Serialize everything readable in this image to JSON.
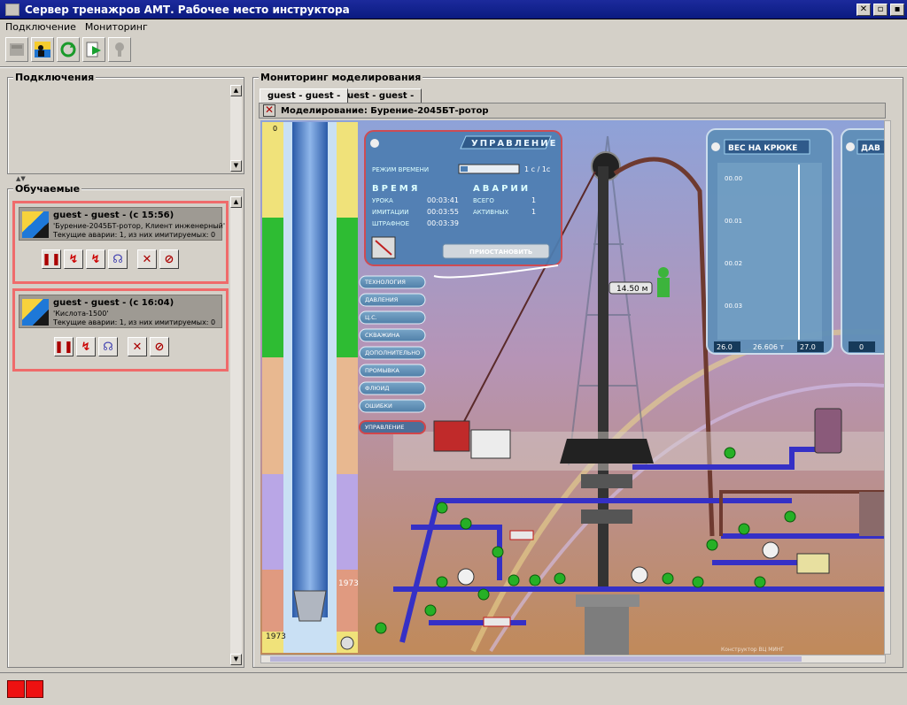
{
  "window": {
    "title": "Сервер тренажров АМТ. Рабочее место инструктора",
    "buttons": [
      "close",
      "restore",
      "minimize"
    ]
  },
  "menu": [
    "Подключение",
    "Мониторинг"
  ],
  "toolbar": [
    {
      "icon": "server-icon",
      "disabled": true
    },
    {
      "icon": "users-connect-icon",
      "disabled": false
    },
    {
      "icon": "refresh-icon",
      "disabled": false
    },
    {
      "icon": "play-icon",
      "disabled": false
    },
    {
      "icon": "person-icon",
      "disabled": true
    }
  ],
  "left": {
    "connections_title": "Подключения",
    "trainees_title": "Обучаемые",
    "trainees": [
      {
        "name": "guest - guest - (с 15:56)",
        "task": "'Бурение-2045БТ-ротор, Клиент инженерный'",
        "status": "Текущие аварии: 1, из них имитируемых: 0"
      },
      {
        "name": "guest - guest - (с 16:04)",
        "task": "'Кислота-1500'",
        "status": "Текущие аварии: 1, из них имитируемых: 0"
      }
    ]
  },
  "monitor": {
    "title": "Мониторинг моделирования",
    "tabs": [
      "guest - guest -",
      "guest - guest -"
    ],
    "sim_title": "Моделирование: Бурение-2045БТ-ротор"
  },
  "sim": {
    "control": {
      "title": "УПРАВЛЕНИЕ",
      "time_mode_label": "РЕЖИМ ВРЕМЕНИ",
      "time_mode_value": "1 с / 1с",
      "time_title": "ВРЕМЯ",
      "accidents_title": "АВАРИИ",
      "rows": [
        {
          "label": "УРОКА",
          "value": "00:03:41"
        },
        {
          "label": "ИМИТАЦИИ",
          "value": "00:03:55"
        },
        {
          "label": "ШТРАФНОЕ",
          "value": "00:03:39"
        }
      ],
      "accidents": [
        {
          "label": "ВСЕГО",
          "value": "1"
        },
        {
          "label": "АКТИВНЫХ",
          "value": "1"
        }
      ],
      "pause_label": "ПРИОСТАНОВИТЬ"
    },
    "menu": [
      "ТЕХНОЛОГИЯ",
      "ДАВЛЕНИЯ",
      "Ц.С.",
      "СКВАЖИНА",
      "ДОПОЛНИТЕЛЬНО",
      "ПРОМЫВКА",
      "ФЛЮИД",
      "ОШИБКИ",
      "УПРАВЛЕНИЕ"
    ],
    "hook": {
      "title": "ВЕС НА КРЮКЕ",
      "ticks": [
        "00.00",
        "00.01",
        "00.02",
        "00.03"
      ],
      "left": "26.0",
      "value": "26.606 т",
      "right": "27.0"
    },
    "pressure": {
      "title": "ДАВ",
      "value": "0"
    },
    "depth_value": "14.50 м",
    "depth_top": "0",
    "depth_mid": "1973",
    "depth_bottom": "1973",
    "copyright": "Конструктор ВЦ МИНГ"
  },
  "colors": {
    "accent": "#ef6b6b",
    "title": "#0a1a80"
  }
}
